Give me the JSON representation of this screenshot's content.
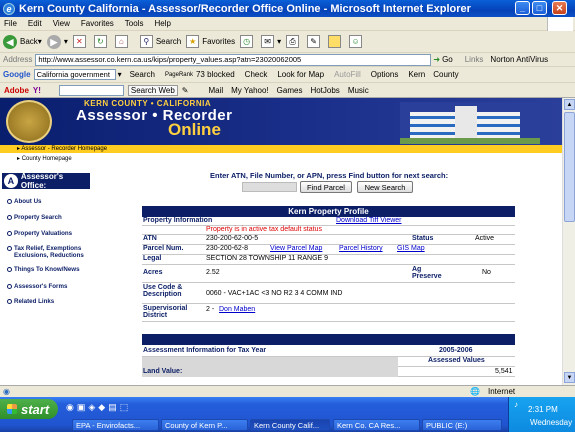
{
  "window": {
    "title": "Kern County California - Assessor/Recorder Office Online - Microsoft Internet Explorer"
  },
  "menu": [
    "File",
    "Edit",
    "View",
    "Favorites",
    "Tools",
    "Help"
  ],
  "toolbar": {
    "back": "Back",
    "search": "Search",
    "favorites": "Favorites"
  },
  "address": {
    "label": "Address",
    "url": "http://www.assessor.co.kern.ca.us/kips/property_values.asp?atn=23020062005",
    "go": "Go",
    "links": "Links",
    "norton": "Norton AntiVirus"
  },
  "google_bar": {
    "label": "Google",
    "query": "California government",
    "search": "Search",
    "pagerank": "PageRank",
    "blocked": "73 blocked",
    "check": "Check",
    "lookfor": "Look for Map",
    "autofill": "AutoFill",
    "options": "Options",
    "kern": "Kern",
    "county": "County"
  },
  "yahoo_bar": {
    "adobe": "Adobe",
    "yahoo": "Y!",
    "searchweb": "Search Web",
    "mail": "Mail",
    "myyahoo": "My Yahoo!",
    "games": "Games",
    "hotjobs": "HotJobs",
    "music": "Music"
  },
  "banner": {
    "line1": "KERN COUNTY • CALIFORNIA",
    "line2": "Assessor • Recorder",
    "line3": "Online"
  },
  "breadcrumbs": [
    "Assessor - Recorder Homepage",
    "County Homepage"
  ],
  "nav": {
    "title": "Assessor's Office:",
    "items": [
      "About Us",
      "Property Search",
      "Property Valuations",
      "Tax Relief, Exemptions Exclusions, Reductions",
      "Things To Know/News",
      "Assessor's Forms",
      "Related Links"
    ]
  },
  "search": {
    "label": "Enter ATN, File Number, or APN, press Find button for next search:",
    "find": "Find Parcel",
    "new": "New Search"
  },
  "profile": {
    "title": "Kern Property Profile",
    "info_label": "Property Information",
    "tiff_link": "Download Tiff Viewer",
    "warning": "Property is in active tax default status",
    "atn_label": "ATN",
    "atn": "230-200-62-00-5",
    "status_label": "Status",
    "status": "Active",
    "parcel_label": "Parcel Num.",
    "parcel": "230-200-62-8",
    "view_map": "View Parcel Map",
    "history": "Parcel History",
    "gis": "GIS Map",
    "legal_label": "Legal",
    "legal": "SECTION 28 TOWNSHIP 11 RANGE 9",
    "acres_label": "Acres",
    "acres": "2.52",
    "ag_label": "Ag Preserve",
    "ag": "No",
    "use_label": "Use Code & Description",
    "use": "0060 - VAC+1AC <3 NO R2 3 4 COMM IND",
    "sup_label": "Supervisorial District",
    "sup_num": "2 -",
    "sup_name": "Don Maben"
  },
  "tax": {
    "label": "Assessment Information for Tax Year",
    "year": "2005-2006",
    "assessed": "Assessed Values",
    "land_label": "Land Value:",
    "land": "5,541"
  },
  "statusbar": {
    "zone": "Internet"
  },
  "taskbar": {
    "start": "start",
    "tasks": [
      "EPA - Envirofacts...",
      "County of Kern P...",
      "Kern County Calif...",
      "Kern Co. CA Res...",
      "PUBLIC (E:)"
    ],
    "time": "2:31 PM",
    "day": "Wednesday"
  }
}
